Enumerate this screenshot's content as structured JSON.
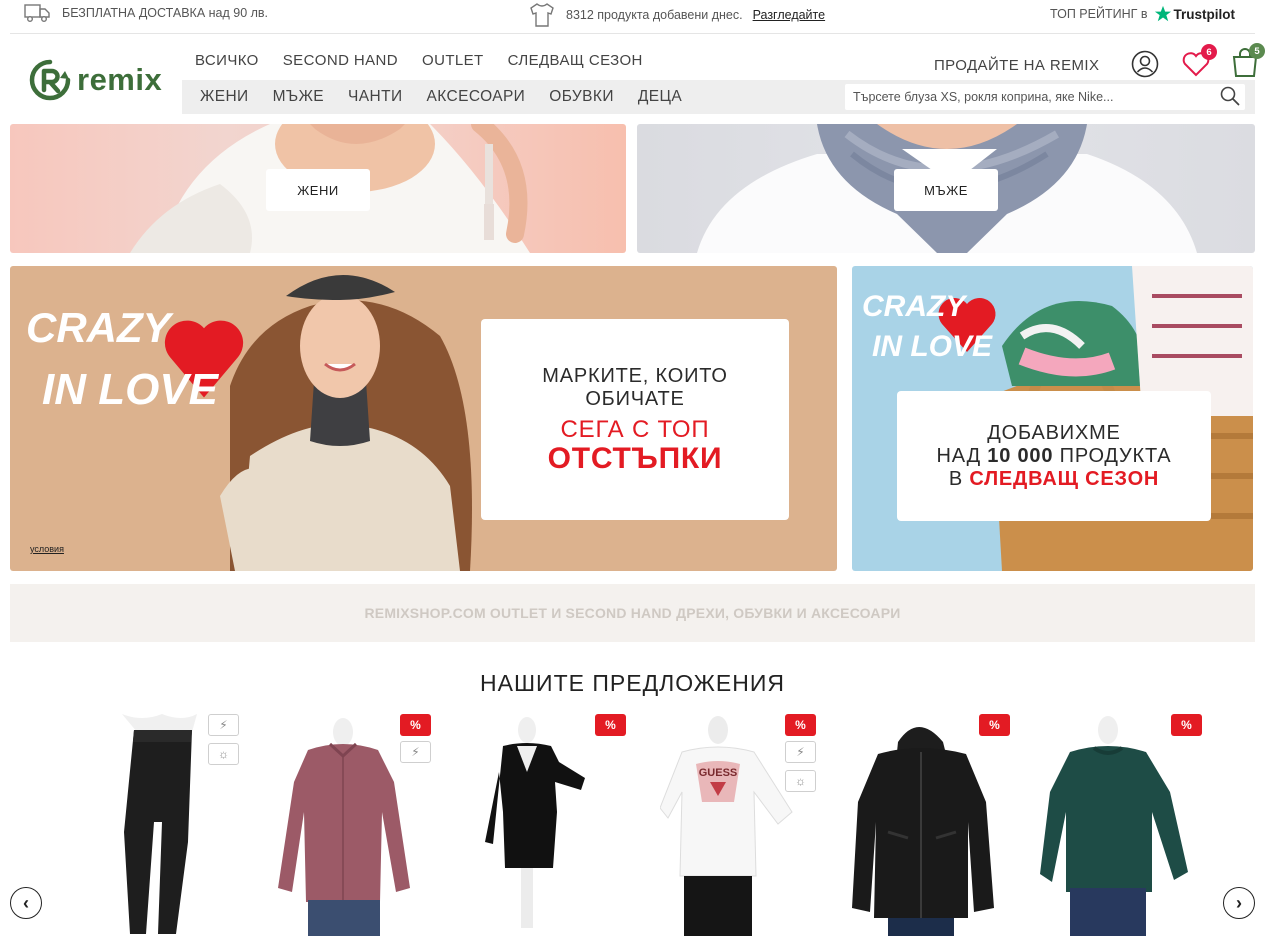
{
  "topbar": {
    "shipping": "БЕЗПЛАТНА ДОСТАВКА над 90 лв.",
    "added_text": "8312 продукта добавени днес.",
    "added_link": "Разгледайте",
    "rating_label": "ТОП РЕЙТИНГ в",
    "trustpilot": "Trustpilot"
  },
  "brand": {
    "name": "remix",
    "color": "#3d6e3a"
  },
  "nav_primary": [
    "ВСИЧКО",
    "SECOND HAND",
    "OUTLET",
    "СЛЕДВАЩ СЕЗОН"
  ],
  "nav_secondary": [
    "ЖЕНИ",
    "МЪЖЕ",
    "ЧАНТИ",
    "АКСЕСОАРИ",
    "ОБУВКИ",
    "ДЕЦА"
  ],
  "header": {
    "sell_label": "ПРОДАЙТЕ НА REMIX",
    "wishlist_count": "6",
    "cart_count": "5",
    "search_placeholder": "Търсете блуза XS, рокля коприна, яке Nike..."
  },
  "banners": {
    "women_button": "ЖЕНИ",
    "men_button": "МЪЖЕ",
    "crazy": {
      "logo_line1": "CRAZY",
      "logo_line2": "IN LOVE",
      "line1": "МАРКИТЕ, КОИТО",
      "line2": "ОБИЧАТЕ",
      "line3": "СЕГА С ТОП",
      "line4": "ОТСТЪПКИ",
      "conditions": "условия"
    },
    "season": {
      "logo_line1": "CRAZY",
      "logo_line2": "IN LOVE",
      "line1": "ДОБАВИХМЕ",
      "line2_pre": "НАД ",
      "line2_bold": "10 000",
      "line2_post": " ПРОДУКТА",
      "line3_pre": "В ",
      "line3_bold": "СЛЕДВАЩ СЕЗОН"
    }
  },
  "strip_text": "REMIXSHOP.COM OUTLET И SECOND HAND ДРЕХИ, ОБУВКИ И АКСЕСОАРИ",
  "offers": {
    "title": "НАШИТЕ ПРЕДЛОЖЕНИЯ",
    "sale_symbol": "%",
    "products": [
      {
        "item": "pants",
        "color": "#1e1e1e",
        "tags": [
          "flash",
          "sun"
        ]
      },
      {
        "item": "shirt",
        "color": "#9c5a67",
        "tags": [
          "sale",
          "flash"
        ]
      },
      {
        "item": "dress",
        "color": "#111111",
        "tags": [
          "sale"
        ]
      },
      {
        "item": "tshirt",
        "color": "#f5f5f5",
        "tags": [
          "sale",
          "flash",
          "sun"
        ]
      },
      {
        "item": "jacket",
        "color": "#1a1a1a",
        "tags": [
          "sale"
        ]
      },
      {
        "item": "sweater",
        "color": "#1e4c46",
        "tags": [
          "sale"
        ]
      }
    ]
  },
  "colors": {
    "accent_red": "#e31b23",
    "brand_green": "#3d6e3a",
    "nav_bg": "#eeeeee"
  }
}
